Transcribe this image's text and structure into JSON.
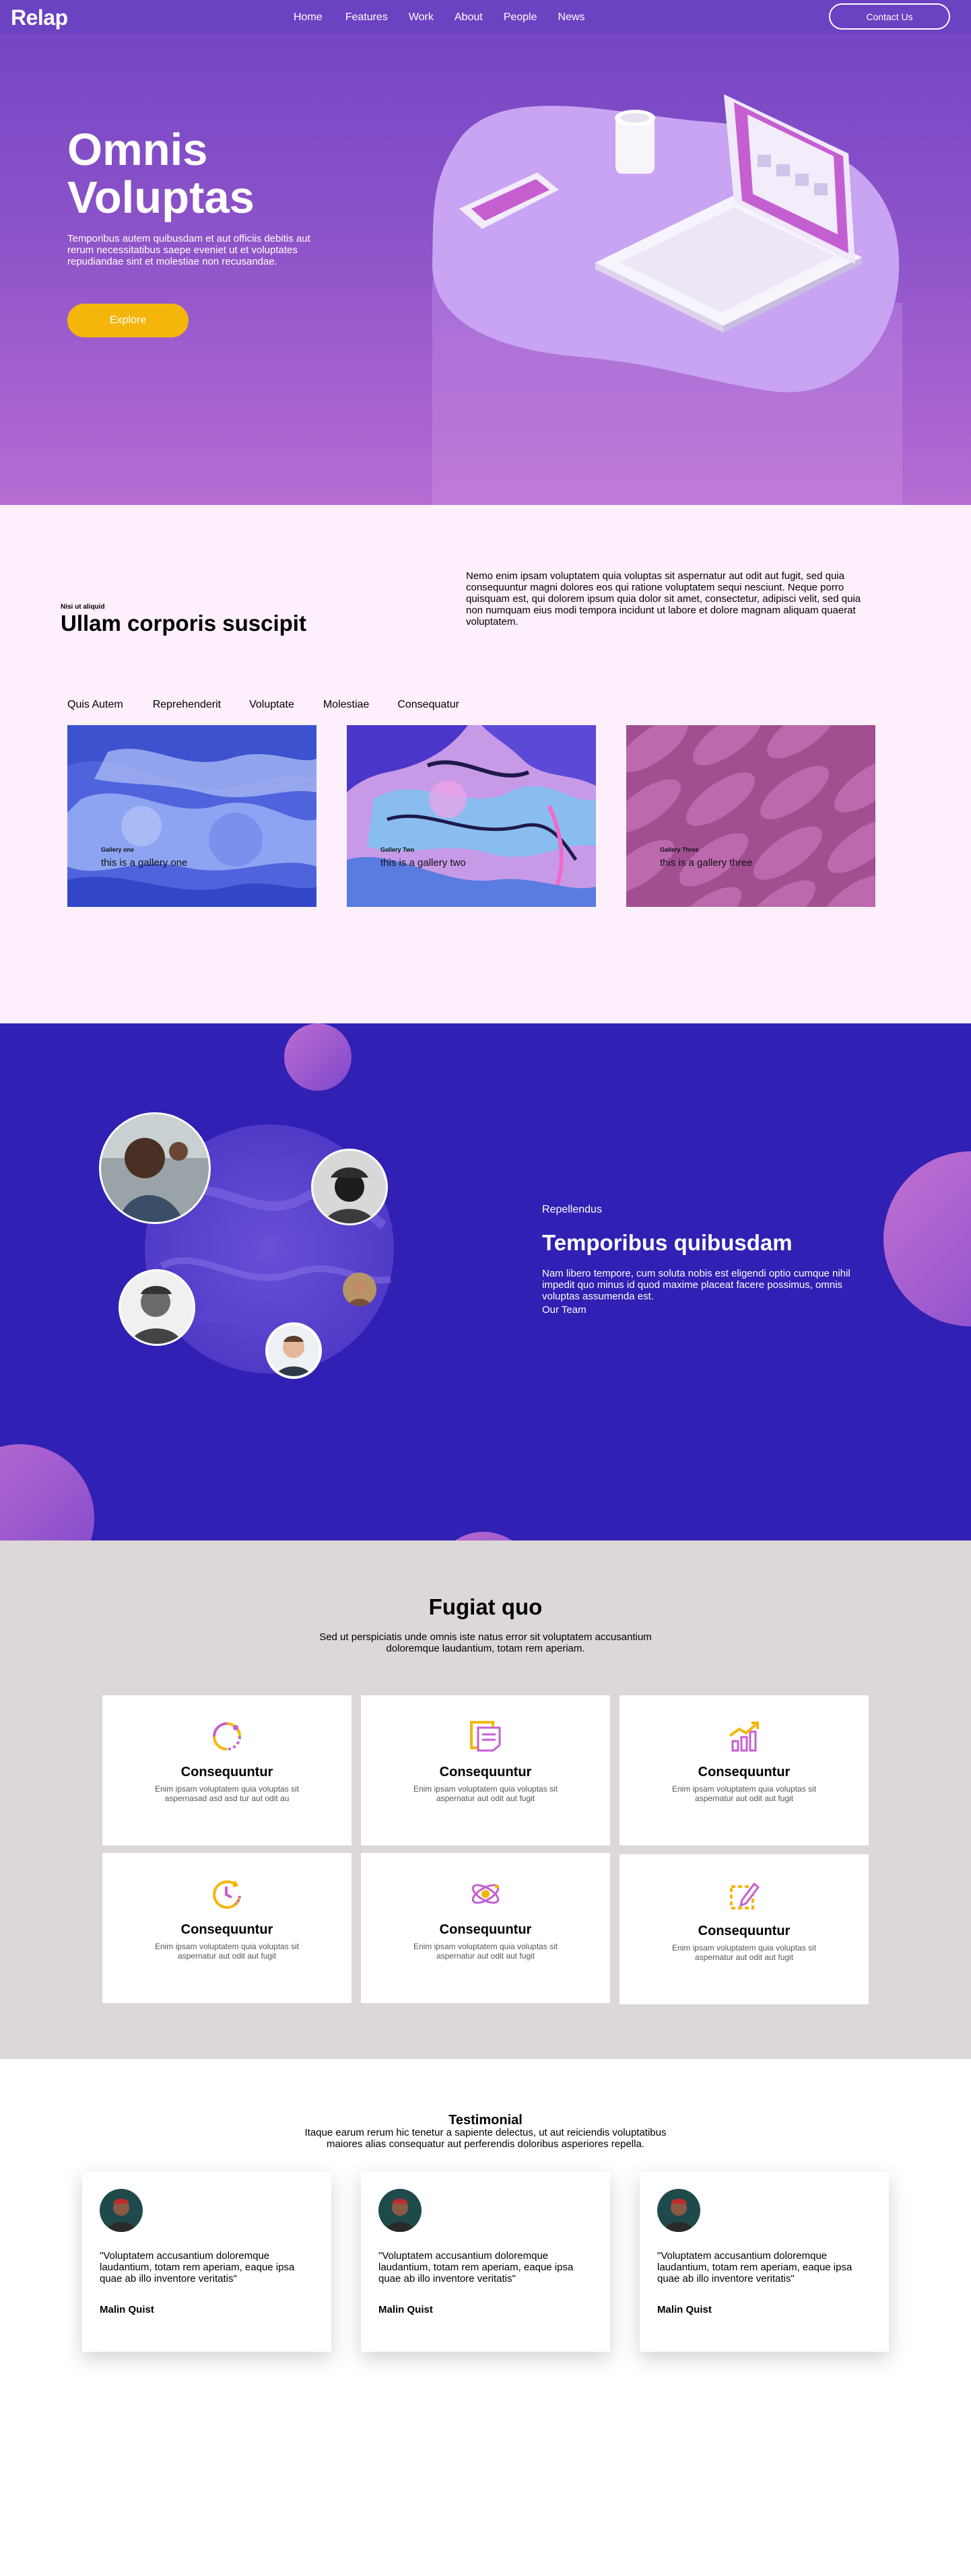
{
  "nav": {
    "logo": "Relap",
    "items": [
      "Home",
      "Features",
      "Work",
      "About",
      "People",
      "News"
    ],
    "contact": "Contact Us"
  },
  "hero": {
    "title_line1": "Omnis",
    "title_line2": "Voluptas",
    "text": "Temporibus autem quibusdam et aut officiis debitis aut rerum necessitatibus saepe eveniet ut et voluptates repudiandae sint et molestiae non recusandae.",
    "button": "Explore"
  },
  "gallery_section": {
    "eyebrow": "Nisi ut aliquid",
    "title": "Ullam corporis suscipit",
    "paragraph": "Nemo enim ipsam voluptatem quia voluptas sit aspernatur aut odit aut fugit, sed quia consequuntur magni dolores eos qui ratione voluptatem sequi nesciunt. Neque porro quisquam est, qui dolorem ipsum quia dolor sit amet, consectetur, adipisci velit, sed quia non numquam eius modi tempora incidunt ut labore et dolore magnam aliquam quaerat voluptatem.",
    "tabs": [
      "Quis Autem",
      "Reprehenderit",
      "Voluptate",
      "Molestiae",
      "Consequatur"
    ],
    "cards": [
      {
        "small": "Gallery one",
        "caption": "this is a gallery one"
      },
      {
        "small": "Gallery Two",
        "caption": "this is a gallery two"
      },
      {
        "small": "Gallery Three",
        "caption": "this is a gallery three"
      }
    ]
  },
  "team_section": {
    "eyebrow": "Repellendus",
    "title": "Temporibus quibusdam",
    "paragraph": "Nam libero tempore, cum soluta nobis est eligendi optio cumque nihil impedit quo minus id quod maxime placeat facere possimus, omnis voluptas assumenda est.",
    "link": "Our Team"
  },
  "features_section": {
    "title": "Fugiat quo",
    "subtitle": "Sed ut perspiciatis unde omnis iste natus error sit voluptatem accusantium doloremque laudantium, totam rem aperiam.",
    "features": [
      {
        "icon": "sync-icon",
        "title": "Consequuntur",
        "desc": "Enim ipsam voluptatem quia voluptas sit aspernasad asd asd tur aut odit au"
      },
      {
        "icon": "document-icon",
        "title": "Consequuntur",
        "desc": "Enim ipsam voluptatem quia voluptas sit aspernatur aut odit aut fugit"
      },
      {
        "icon": "chart-icon",
        "title": "Consequuntur",
        "desc": "Enim ipsam voluptatem quia voluptas sit aspernatur aut odit aut fugit"
      },
      {
        "icon": "clock-icon",
        "title": "Consequuntur",
        "desc": "Enim ipsam voluptatem quia voluptas sit aspernatur aut odit aut fugit"
      },
      {
        "icon": "atom-icon",
        "title": "Consequuntur",
        "desc": "Enim ipsam voluptatem quia voluptas sit aspernatur aut odit aut fugit"
      },
      {
        "icon": "edit-icon",
        "title": "Consequuntur",
        "desc": "Enim ipsam voluptatem quia voluptas sit aspernatur aut odit aut fugit"
      }
    ]
  },
  "testimonial_section": {
    "title": "Testimonial",
    "subtitle": "Itaque earum rerum hic tenetur a sapiente delectus, ut aut reiciendis voluptatibus maiores alias consequatur aut perferendis doloribus asperiores repella.",
    "cards": [
      {
        "quote": "\"Voluptatem accusantium doloremque laudantium, totam rem aperiam, eaque ipsa quae ab illo inventore veritatis\"",
        "name": "Malin Quist"
      },
      {
        "quote": "\"Voluptatem accusantium doloremque laudantium, totam rem aperiam, eaque ipsa quae ab illo inventore veritatis\"",
        "name": "Malin Quist"
      },
      {
        "quote": "\"Voluptatem accusantium doloremque laudantium, totam rem aperiam, eaque ipsa quae ab illo inventore veritatis\"",
        "name": "Malin Quist"
      }
    ]
  },
  "colors": {
    "nav": "#6b42c2",
    "accent_yellow": "#f5b60b",
    "team_bg": "#3020b3",
    "features_bg": "#ddd7d7",
    "gallery_bg": "#fdf0fc"
  }
}
